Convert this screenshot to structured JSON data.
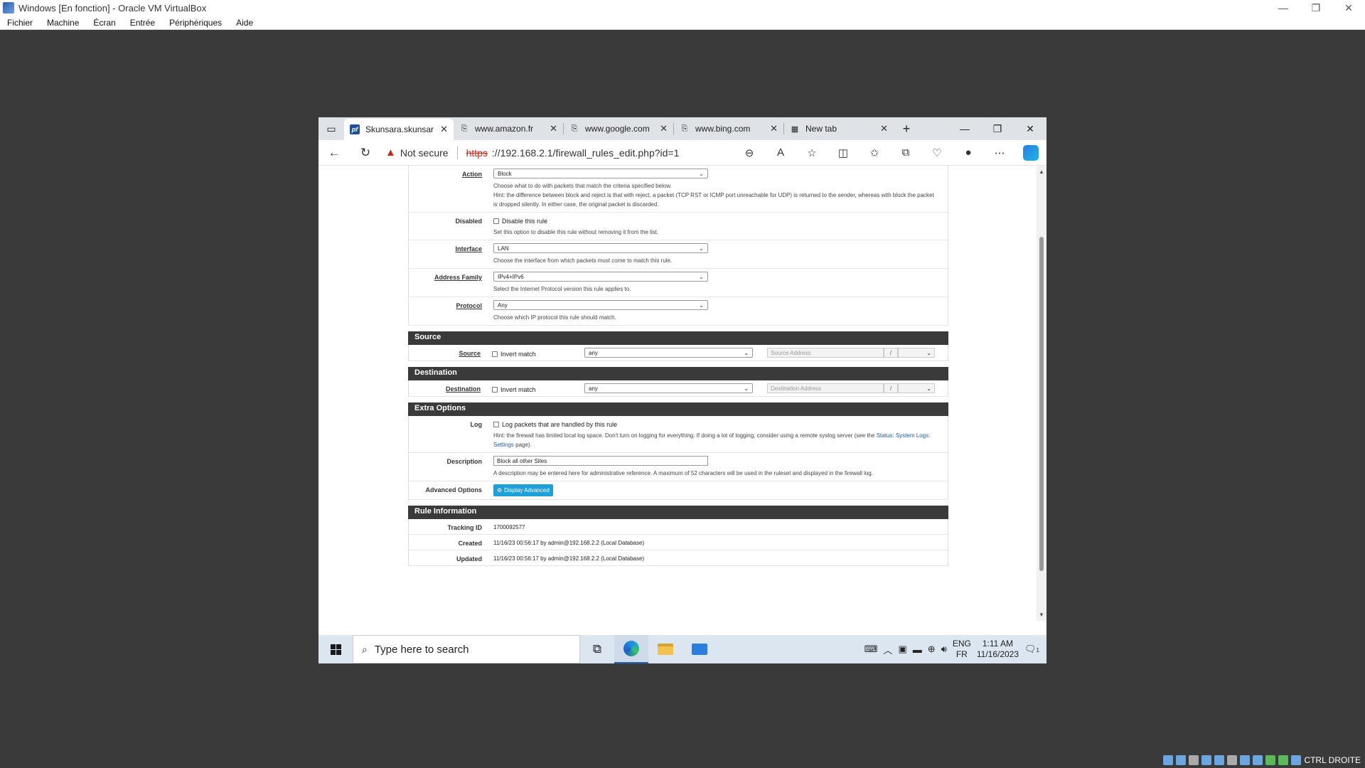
{
  "vbox": {
    "title": "Windows [En fonction] - Oracle VM VirtualBox",
    "menu": [
      "Fichier",
      "Machine",
      "Écran",
      "Entrée",
      "Périphériques",
      "Aide"
    ],
    "host_key": "CTRL DROITE"
  },
  "browser": {
    "tabs": [
      {
        "label": "Skunsara.skunsar",
        "icon": "pfsense-icon",
        "active": true
      },
      {
        "label": "www.amazon.fr",
        "icon": "page-icon"
      },
      {
        "label": "www.google.com",
        "icon": "page-icon"
      },
      {
        "label": "www.bing.com",
        "icon": "page-icon"
      },
      {
        "label": "New tab",
        "icon": "newtab-icon"
      }
    ],
    "not_secure": "Not secure",
    "url_scheme": "https",
    "url_rest": "://192.168.2.1/firewall_rules_edit.php?id=1"
  },
  "form": {
    "action": {
      "label": "Action",
      "value": "Block",
      "help1": "Choose what to do with packets that match the criteria specified below.",
      "help2": "Hint: the difference between block and reject is that with reject, a packet (TCP RST or ICMP port unreachable for UDP) is returned to the sender, whereas with block the packet is dropped silently. In either case, the original packet is discarded."
    },
    "disabled": {
      "label": "Disabled",
      "checkbox": "Disable this rule",
      "help": "Set this option to disable this rule without removing it from the list."
    },
    "interface": {
      "label": "Interface",
      "value": "LAN",
      "help": "Choose the interface from which packets must come to match this rule."
    },
    "family": {
      "label": "Address Family",
      "value": "IPv4+IPv6",
      "help": "Select the Internet Protocol version this rule applies to."
    },
    "protocol": {
      "label": "Protocol",
      "value": "Any",
      "help": "Choose which IP protocol this rule should match."
    },
    "source_section": "Source",
    "source": {
      "label": "Source",
      "invert": "Invert match",
      "type": "any",
      "placeholder": "Source Address",
      "slash": "/"
    },
    "destination_section": "Destination",
    "destination": {
      "label": "Destination",
      "invert": "Invert match",
      "type": "any",
      "placeholder": "Destination Address",
      "slash": "/"
    },
    "extra_section": "Extra Options",
    "log": {
      "label": "Log",
      "checkbox": "Log packets that are handled by this rule",
      "help_pre": "Hint: the firewall has limited local log space. Don't turn on logging for everything. If doing a lot of logging, consider using a remote syslog server (see the ",
      "help_link": "Status: System Logs: Settings",
      "help_post": " page)."
    },
    "description": {
      "label": "Description",
      "value": "Block all other Sites",
      "help": "A description may be entered here for administrative reference. A maximum of 52 characters will be used in the ruleset and displayed in the firewall log."
    },
    "advanced": {
      "label": "Advanced Options",
      "button": "Display Advanced"
    },
    "info_section": "Rule Information",
    "tracking": {
      "label": "Tracking ID",
      "value": "1700092577"
    },
    "created": {
      "label": "Created",
      "value": "11/16/23 00:56:17 by admin@192.168.2.2 (Local Database)"
    },
    "updated": {
      "label": "Updated",
      "value": "11/16/23 00:56:17 by admin@192.168.2.2 (Local Database)"
    }
  },
  "taskbar": {
    "search_placeholder": "Type here to search",
    "lang_top": "ENG",
    "lang_bottom": "FR",
    "time": "1:11 AM",
    "date": "11/16/2023",
    "notif_count": "1"
  }
}
